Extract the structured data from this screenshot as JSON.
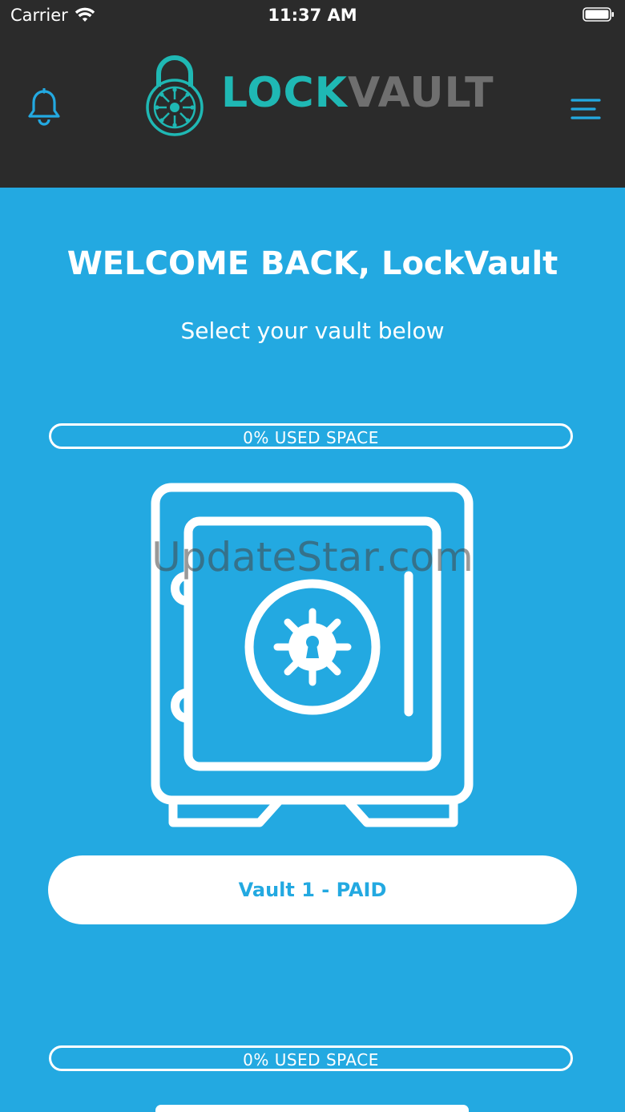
{
  "status_bar": {
    "carrier": "Carrier",
    "time": "11:37 AM"
  },
  "header": {
    "logo_lock": "LOCK",
    "logo_vault": "VAULT",
    "notification_icon": "bell-icon",
    "menu_icon": "hamburger-menu-icon",
    "colors": {
      "background": "#2b2b2b",
      "icon": "#23a9e1",
      "logo_teal": "#1fb8b4",
      "logo_gray": "#6f6f6f"
    }
  },
  "main": {
    "welcome": "WELCOME BACK, LockVault",
    "subtitle": "Select your vault below",
    "background_color": "#23a9e1",
    "vaults": [
      {
        "usage_label": "0% USED SPACE",
        "used_fraction": 0,
        "button_label": "Vault 1 - PAID",
        "icon": "safe-icon"
      },
      {
        "usage_label": "0% USED SPACE",
        "used_fraction": 0,
        "button_label": "",
        "icon": "safe-icon"
      }
    ]
  },
  "watermark": "UpdateStar.com"
}
